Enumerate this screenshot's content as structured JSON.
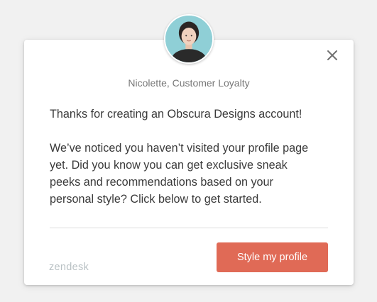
{
  "sender": "Nicolette, Customer Loyalty",
  "message": {
    "greeting": "Thanks for creating an Obscura Designs account!",
    "body_lines": [
      "We’ve noticed you haven’t visited your profile page",
      "yet. Did you know you can get exclusive sneak",
      "peeks and recommendations based on your",
      "personal style? Click below to get started."
    ]
  },
  "cta": {
    "label": "Style my profile",
    "color": "#e06a56"
  },
  "brand": "zendesk",
  "icons": {
    "close": "close-icon",
    "avatar": "avatar"
  }
}
